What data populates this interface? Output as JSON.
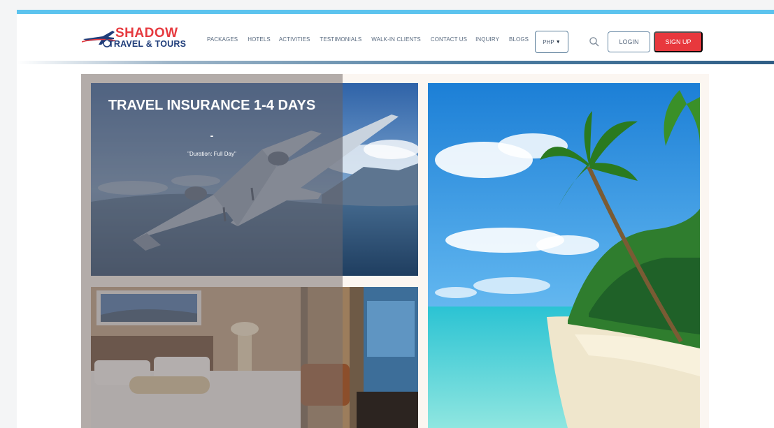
{
  "brand": {
    "name_top": "SHADOW",
    "name_bottom": "TRAVEL & TOURS",
    "primary_red": "#e63a3f",
    "primary_navy": "#1f3d7a"
  },
  "nav": {
    "items": [
      {
        "label": "PACKAGES"
      },
      {
        "label": "HOTELS"
      },
      {
        "label": "ACTIVITIES"
      },
      {
        "label": "TESTIMONIALS"
      },
      {
        "label": "WALK-IN CLIENTS"
      },
      {
        "label": "CONTACT US"
      },
      {
        "label": "INQUIRY"
      },
      {
        "label": "BLOGS"
      }
    ]
  },
  "currency": {
    "selected": "PHP",
    "icon": "caret-down-icon"
  },
  "search": {
    "icon": "search-icon"
  },
  "auth": {
    "login_label": "LOGIN",
    "signup_label": "SIGN UP",
    "signup_color": "#e8383d"
  },
  "featured": {
    "title": "TRAVEL INSURANCE 1-4 DAYS",
    "dash": "-",
    "duration": "\"Duration: Full Day\""
  },
  "accent_color": "#5cc3ee"
}
